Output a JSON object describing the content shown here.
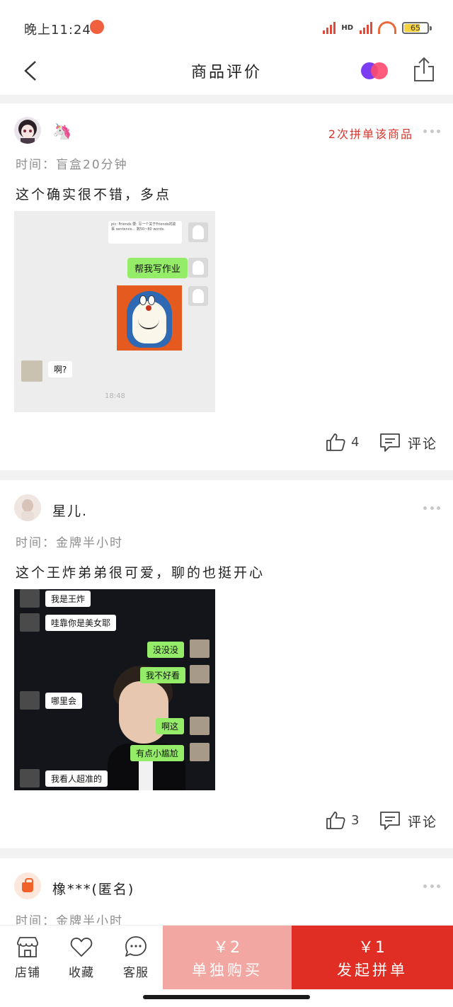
{
  "status_bar": {
    "time": "晚上11:24",
    "network_label": "HD",
    "battery": "65"
  },
  "nav": {
    "title": "商品评价"
  },
  "reviews": [
    {
      "username": "",
      "badge_emoji": "🦄",
      "order_tag": "2次拼单该商品",
      "time": "时间：盲盒20分钟",
      "text": "这个确实很不错，多点",
      "likes": "4",
      "comment_label": "评论",
      "image": {
        "top_text": "pic: Friends 要: 写一个关于Friends的故事 sentence... 数50~80 words.",
        "bubble_green": "帮我写作业",
        "bubble_reply": "啊?",
        "time": "18:48"
      }
    },
    {
      "username": "星儿.",
      "time": "时间：金牌半小时",
      "text": "这个王炸弟弟很可爱，聊的也挺开心",
      "likes": "3",
      "comment_label": "评论",
      "image": {
        "b1": "我是王炸",
        "b2": "哇靠你是美女耶",
        "b3": "没没没",
        "b4": "我不好看",
        "b5": "哪里会",
        "b6": "啊这",
        "b7": "有点小尴尬",
        "b8": "我看人超准的"
      }
    },
    {
      "username": "橡***(匿名)",
      "time": "时间：金牌半小时"
    }
  ],
  "bottom_bar": {
    "store": "店铺",
    "favorite": "收藏",
    "service": "客服",
    "single_price": "￥2",
    "single_label": "单独购买",
    "group_price": "￥1",
    "group_label": "发起拼单"
  },
  "colors": {
    "accent": "#e02e24",
    "single_buy_bg": "#f3a7a2",
    "order_tag": "#d8342c"
  }
}
